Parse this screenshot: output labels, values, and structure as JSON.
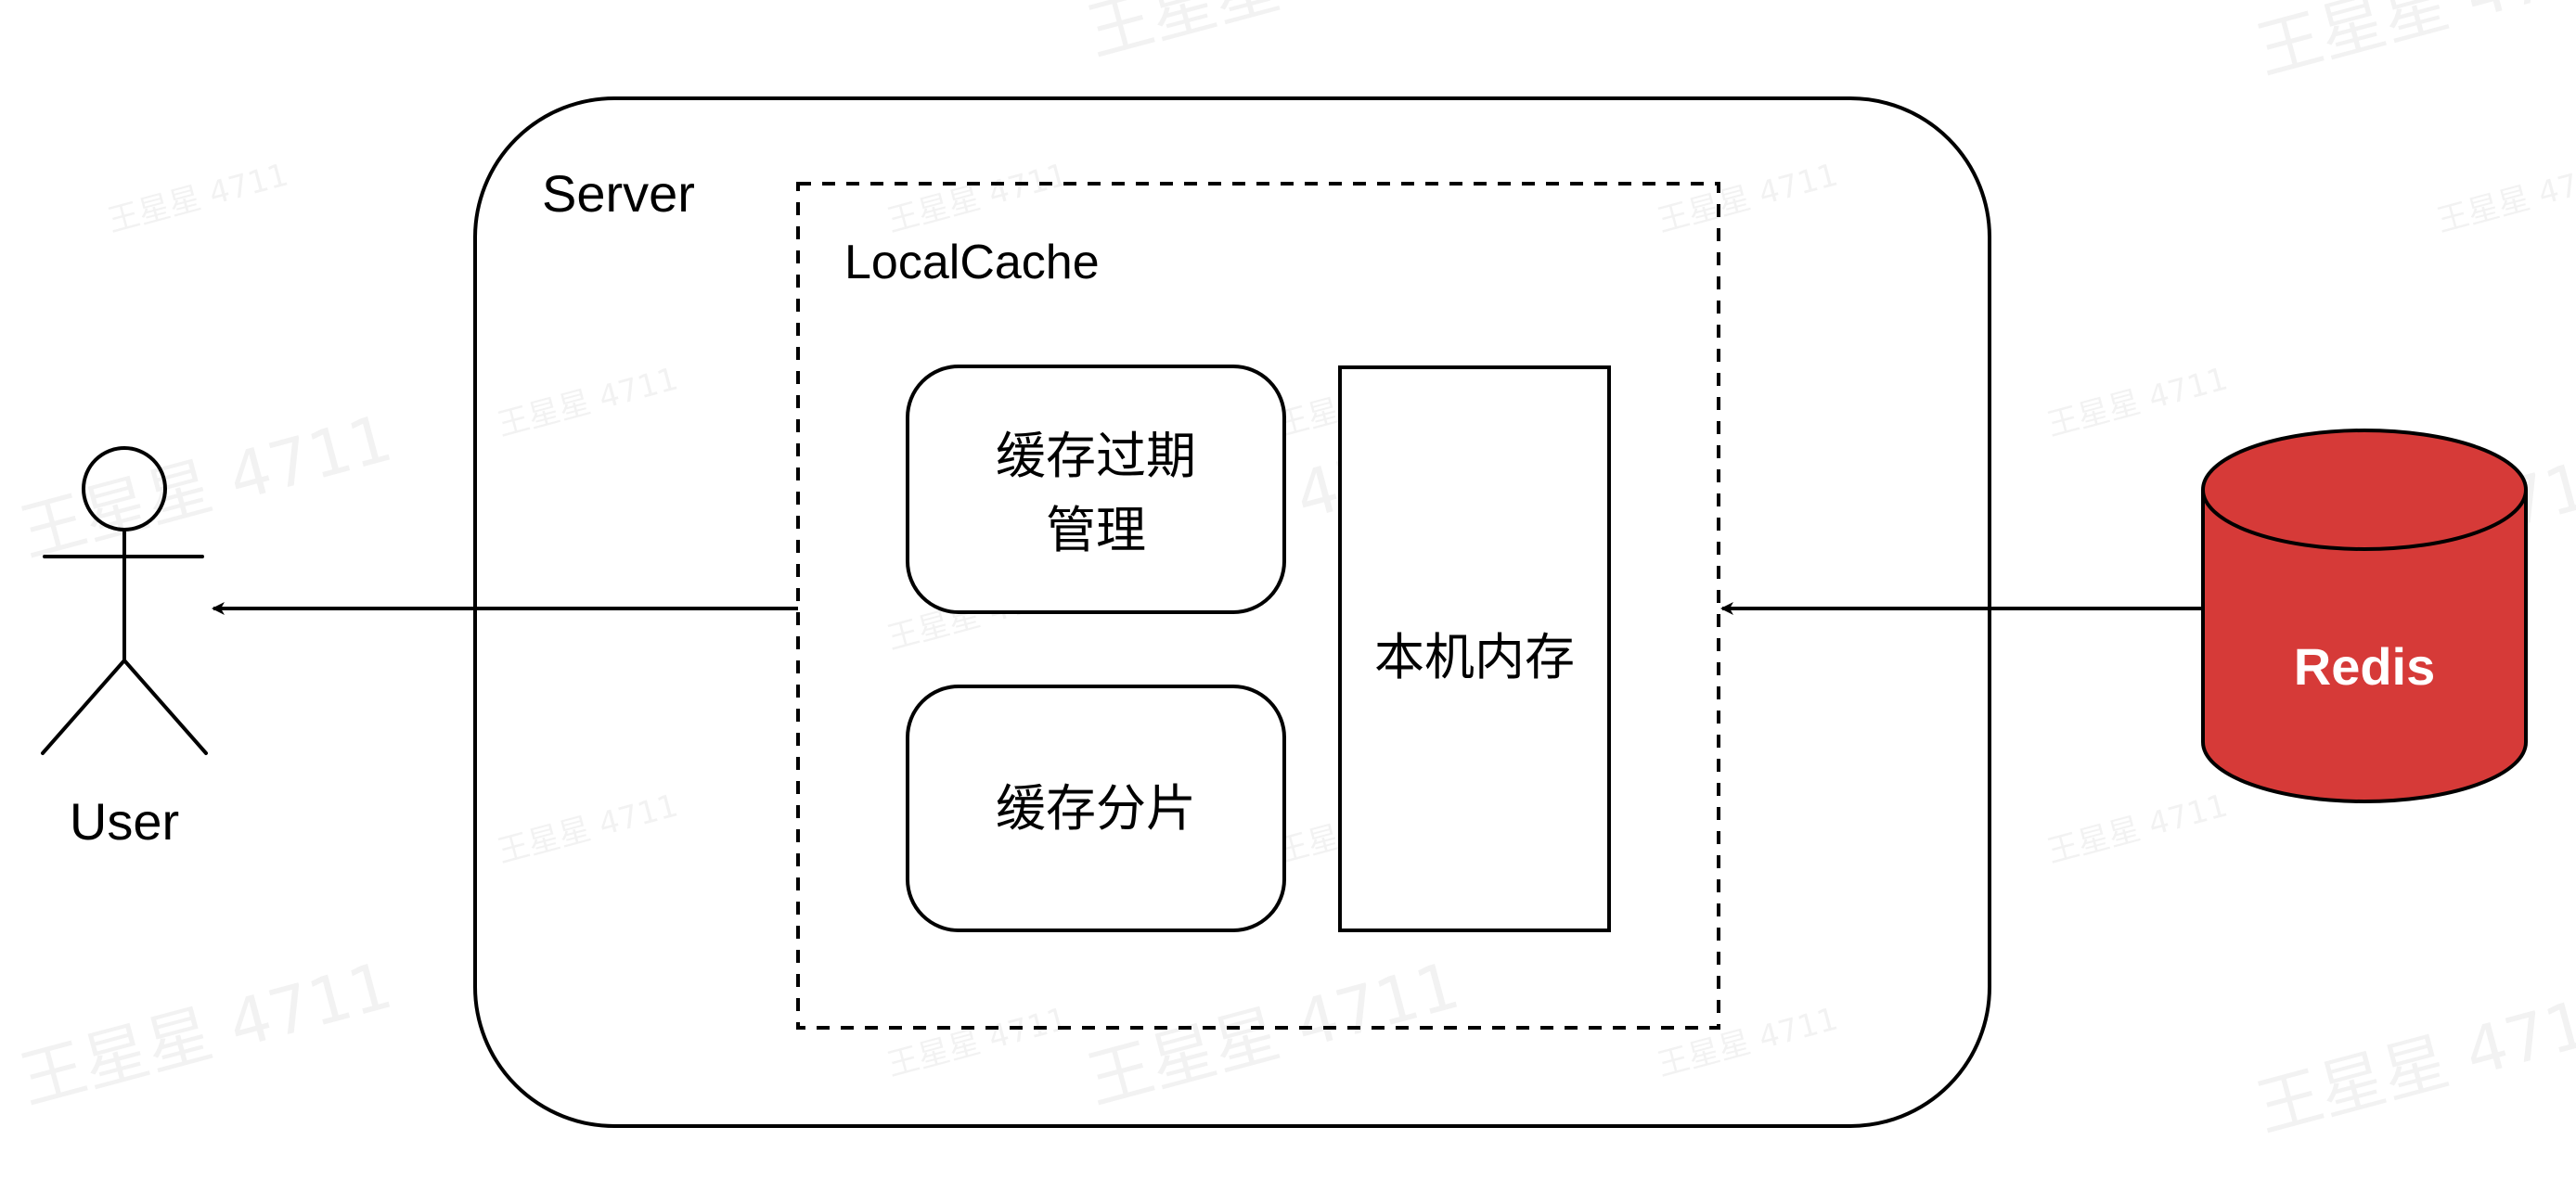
{
  "diagram": {
    "actor": {
      "label": "User"
    },
    "server": {
      "label": "Server"
    },
    "local_cache": {
      "label": "LocalCache",
      "expiry_box": {
        "line1": "缓存过期",
        "line2": "管理"
      },
      "shard_box": {
        "label": "缓存分片"
      },
      "memory_box": {
        "label": "本机内存"
      }
    },
    "redis": {
      "label": "Redis",
      "color": "#d63a38"
    },
    "edges": [
      {
        "from": "LocalCache",
        "to": "User"
      },
      {
        "from": "Redis",
        "to": "LocalCache"
      }
    ]
  },
  "watermark": {
    "text": "王星星 4711"
  }
}
